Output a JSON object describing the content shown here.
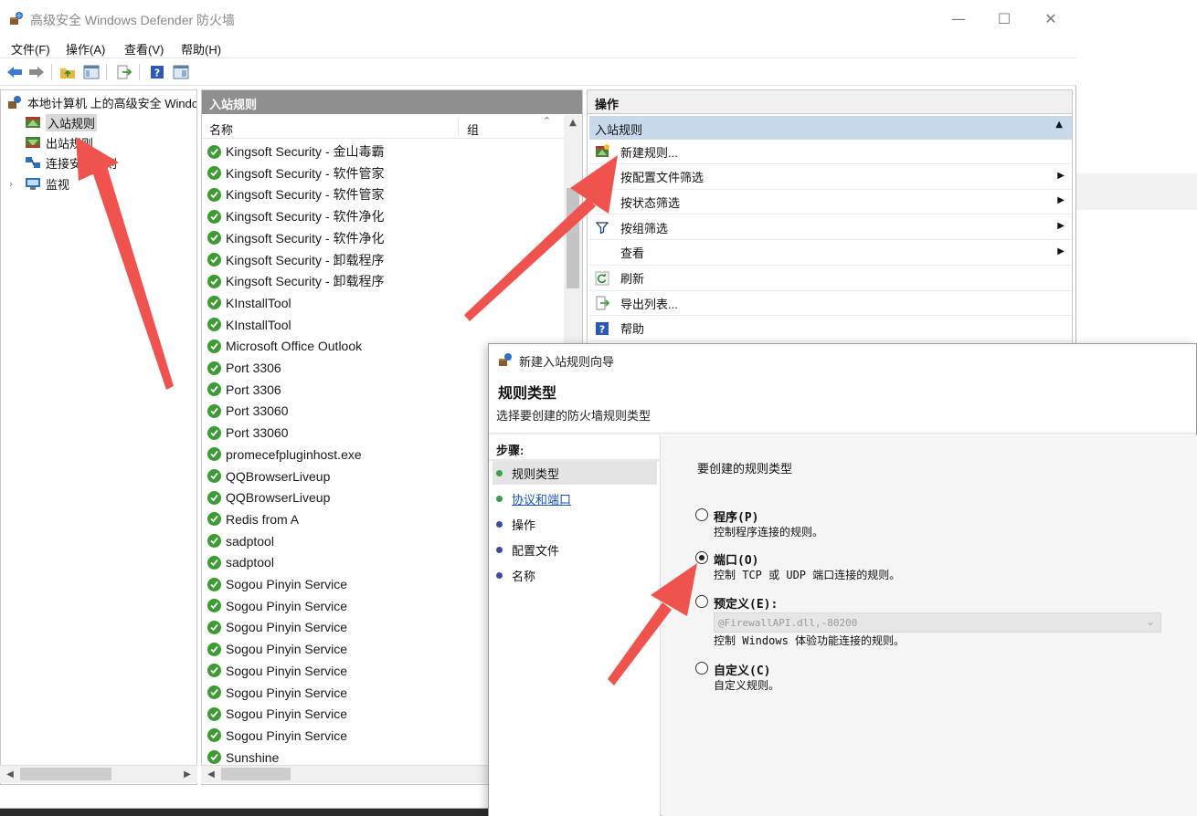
{
  "window": {
    "title": "高级安全 Windows Defender 防火墙",
    "controls": {
      "minimize": "—",
      "maximize": "☐",
      "close": "✕"
    }
  },
  "menu": [
    "文件(F)",
    "操作(A)",
    "查看(V)",
    "帮助(H)"
  ],
  "toolbar": {
    "buttons": [
      "back-icon",
      "forward-icon",
      "up-folder-icon",
      "show-tree-icon",
      "export-icon",
      "help-icon",
      "properties-icon"
    ]
  },
  "tree": {
    "root": "本地计算机 上的高级安全 Windows Defender 防火墙",
    "items": [
      {
        "label": "入站规则",
        "selected": true
      },
      {
        "label": "出站规则"
      },
      {
        "label": "连接安全规则"
      },
      {
        "label": "监视"
      }
    ]
  },
  "list": {
    "header": "入站规则",
    "columns": [
      "名称",
      "组"
    ],
    "rows": [
      "Kingsoft Security - 金山毒霸",
      "Kingsoft Security - 软件管家",
      "Kingsoft Security - 软件管家",
      "Kingsoft Security - 软件净化",
      "Kingsoft Security - 软件净化",
      "Kingsoft Security - 卸载程序",
      "Kingsoft Security - 卸载程序",
      "KInstallTool",
      "KInstallTool",
      "Microsoft Office Outlook",
      "Port 3306",
      "Port 3306",
      "Port 33060",
      "Port 33060",
      "promecefpluginhost.exe",
      "QQBrowserLiveup",
      "QQBrowserLiveup",
      "Redis from A",
      "sadptool",
      "sadptool",
      "Sogou Pinyin Service",
      "Sogou Pinyin Service",
      "Sogou Pinyin Service",
      "Sogou Pinyin Service",
      "Sogou Pinyin Service",
      "Sogou Pinyin Service",
      "Sogou Pinyin Service",
      "Sogou Pinyin Service",
      "Sunshine"
    ]
  },
  "actions": {
    "header": "操作",
    "section": "入站规则",
    "items": [
      {
        "label": "新建规则...",
        "submenu": false,
        "icon": "new-rule-icon"
      },
      {
        "label": "按配置文件筛选",
        "submenu": true,
        "icon": "filter-icon"
      },
      {
        "label": "按状态筛选",
        "submenu": true,
        "icon": "filter-icon"
      },
      {
        "label": "按组筛选",
        "submenu": true,
        "icon": "filter-icon"
      },
      {
        "label": "查看",
        "submenu": true,
        "icon": ""
      },
      {
        "label": "刷新",
        "submenu": false,
        "icon": "refresh-icon"
      },
      {
        "label": "导出列表...",
        "submenu": false,
        "icon": "export-icon"
      },
      {
        "label": "帮助",
        "submenu": false,
        "icon": "help-icon"
      }
    ]
  },
  "wizard": {
    "title": "新建入站规则向导",
    "heading": "规则类型",
    "subheading": "选择要创建的防火墙规则类型",
    "steps_title": "步骤:",
    "steps": [
      {
        "label": "规则类型",
        "state": "active"
      },
      {
        "label": "协议和端口",
        "state": "link"
      },
      {
        "label": "操作",
        "state": "pending"
      },
      {
        "label": "配置文件",
        "state": "pending"
      },
      {
        "label": "名称",
        "state": "pending"
      }
    ],
    "prompt": "要创建的规则类型",
    "options": [
      {
        "label": "程序(P)",
        "desc": "控制程序连接的规则。",
        "selected": false
      },
      {
        "label": "端口(O)",
        "desc": "控制 TCP 或 UDP 端口连接的规则。",
        "selected": true
      },
      {
        "label": "预定义(E):",
        "desc": "控制 Windows 体验功能连接的规则。",
        "selected": false
      },
      {
        "label": "自定义(C)",
        "desc": "自定义规则。",
        "selected": false
      }
    ],
    "predefined_value": "@FirewallAPI.dll,-80200"
  },
  "colors": {
    "accent_section": "#c8d9ec",
    "list_header": "#8f8f8f",
    "check_green": "#3d9b34",
    "arrow_red": "#f0524d",
    "step_done": "#39a043",
    "step_pending": "#3b4aa8"
  }
}
